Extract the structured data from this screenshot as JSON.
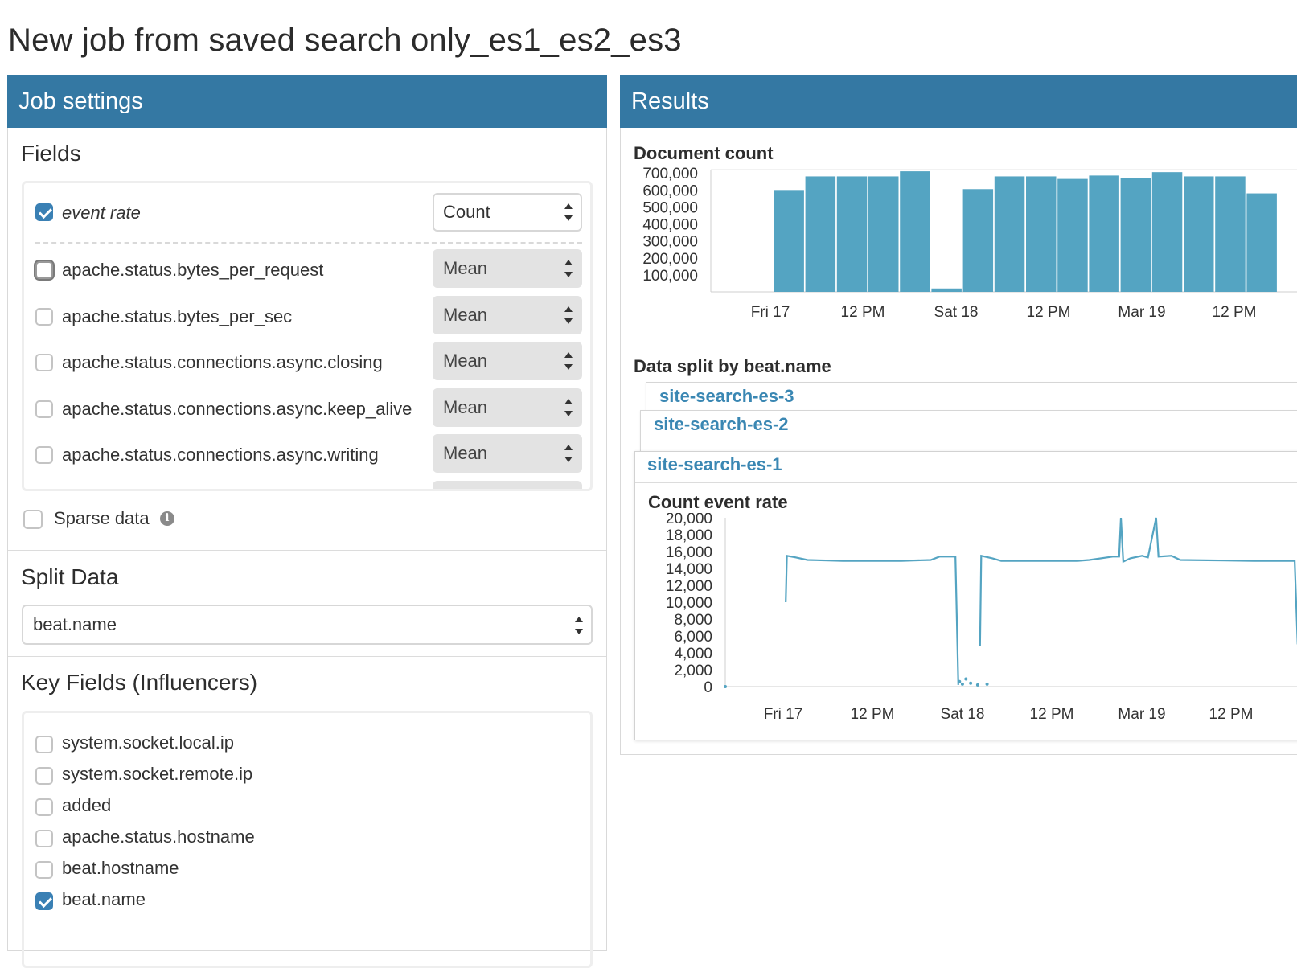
{
  "page": {
    "title": "New job from saved search only_es1_es2_es3"
  },
  "job_settings": {
    "header": "Job settings",
    "fields_title": "Fields",
    "fields": [
      {
        "label": "event rate",
        "checked": true,
        "function": "Count",
        "italic": true
      },
      {
        "label": "apache.status.bytes_per_request",
        "checked": false,
        "function": "Mean"
      },
      {
        "label": "apache.status.bytes_per_sec",
        "checked": false,
        "function": "Mean"
      },
      {
        "label": "apache.status.connections.async.closing",
        "checked": false,
        "function": "Mean"
      },
      {
        "label": "apache.status.connections.async.keep_alive",
        "checked": false,
        "function": "Mean"
      },
      {
        "label": "apache.status.connections.async.writing",
        "checked": false,
        "function": "Mean"
      }
    ],
    "sparse_label": "Sparse data",
    "split_title": "Split Data",
    "split_value": "beat.name",
    "influencers_title": "Key Fields (Influencers)",
    "influencers": [
      {
        "label": "system.socket.local.ip",
        "checked": false
      },
      {
        "label": "system.socket.remote.ip",
        "checked": false
      },
      {
        "label": "added",
        "checked": false
      },
      {
        "label": "apache.status.hostname",
        "checked": false
      },
      {
        "label": "beat.hostname",
        "checked": false
      },
      {
        "label": "beat.name",
        "checked": true
      }
    ]
  },
  "results": {
    "header": "Results",
    "doc_count_title": "Document count",
    "split_title": "Data split by beat.name",
    "split_tabs": [
      "site-search-es-3",
      "site-search-es-2",
      "site-search-es-1"
    ],
    "event_rate_title": "Count event rate"
  },
  "colors": {
    "header_blue": "#3478a3",
    "bar_blue": "#54a4c2",
    "link_blue": "#3a87b3"
  },
  "chart_data": [
    {
      "type": "bar",
      "name": "doc_count",
      "x_ticks": [
        "Fri 17",
        "12 PM",
        "Sat 18",
        "12 PM",
        "Mar 19",
        "12 PM"
      ],
      "y_ticks": [
        "700,000",
        "600,000",
        "500,000",
        "400,000",
        "300,000",
        "200,000",
        "100,000"
      ],
      "ylim": [
        0,
        720000
      ],
      "values": [
        0,
        0,
        600000,
        680000,
        680000,
        680000,
        710000,
        20000,
        605000,
        680000,
        680000,
        665000,
        685000,
        670000,
        705000,
        680000,
        680000,
        580000
      ]
    },
    {
      "type": "line",
      "name": "count_event_rate",
      "x_ticks": [
        "Fri 17",
        "12 PM",
        "Sat 18",
        "12 PM",
        "Mar 19",
        "12 PM"
      ],
      "y_ticks": [
        "20,000",
        "18,000",
        "16,000",
        "14,000",
        "12,000",
        "10,000",
        "8,000",
        "6,000",
        "4,000",
        "2,000",
        "0"
      ],
      "ylim": [
        0,
        20000
      ],
      "segments": [
        [
          [
            0.103,
            10000
          ],
          [
            0.105,
            15500
          ],
          [
            0.12,
            15300
          ],
          [
            0.14,
            15000
          ],
          [
            0.2,
            14900
          ],
          [
            0.3,
            14900
          ],
          [
            0.35,
            15000
          ],
          [
            0.365,
            15400
          ],
          [
            0.392,
            15400
          ],
          [
            0.397,
            200
          ]
        ],
        [
          [
            0.434,
            4800
          ],
          [
            0.436,
            15500
          ],
          [
            0.455,
            15200
          ],
          [
            0.47,
            14900
          ],
          [
            0.6,
            14900
          ],
          [
            0.62,
            15000
          ],
          [
            0.66,
            15400
          ],
          [
            0.671,
            15400
          ],
          [
            0.674,
            20000
          ],
          [
            0.678,
            14800
          ],
          [
            0.69,
            15200
          ],
          [
            0.71,
            15500
          ],
          [
            0.72,
            15300
          ],
          [
            0.734,
            20000
          ],
          [
            0.738,
            15400
          ],
          [
            0.76,
            15500
          ],
          [
            0.775,
            15000
          ],
          [
            0.9,
            14900
          ],
          [
            0.97,
            14900
          ],
          [
            0.975,
            5000
          ]
        ]
      ],
      "points": [
        [
          0.0,
          0
        ],
        [
          0.399,
          600
        ],
        [
          0.404,
          300
        ],
        [
          0.41,
          900
        ],
        [
          0.418,
          400
        ],
        [
          0.43,
          200
        ],
        [
          0.446,
          300
        ],
        [
          0.997,
          200
        ]
      ]
    }
  ]
}
